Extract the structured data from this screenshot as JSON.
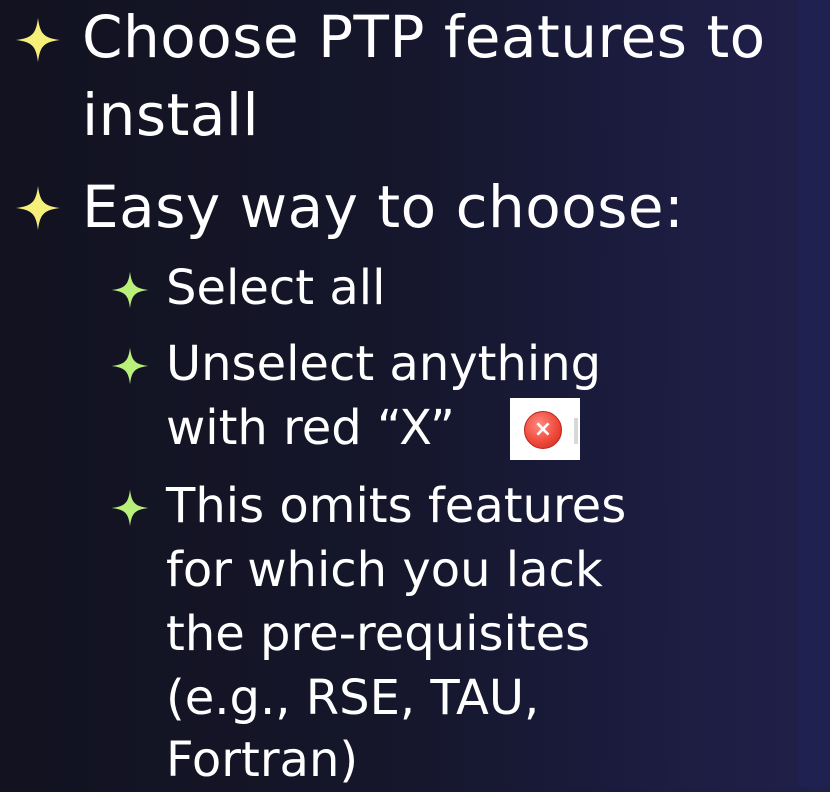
{
  "bullets": [
    {
      "level": 1,
      "icon": "sparkle-star-icon",
      "lines": [
        "Choose PTP features to",
        "install"
      ]
    },
    {
      "level": 1,
      "icon": "sparkle-star-icon",
      "lines": [
        "Easy way to choose:"
      ]
    },
    {
      "level": 2,
      "icon": "sparkle-star-icon",
      "lines": [
        "Select all"
      ]
    },
    {
      "level": 2,
      "icon": "sparkle-star-icon",
      "lines": [
        "Unselect anything",
        "with red “X”"
      ],
      "inline_icon": "red-x-error-icon"
    },
    {
      "level": 2,
      "icon": "sparkle-star-icon",
      "lines": [
        "This omits features",
        "for which you lack",
        "the pre-requisites",
        "(e.g., RSE, TAU,",
        "Fortran)"
      ]
    }
  ],
  "colors": {
    "level1_star": "#f6f07a",
    "level2_star": "#b8f07a",
    "text": "#ffffff",
    "background": "#15162a"
  }
}
